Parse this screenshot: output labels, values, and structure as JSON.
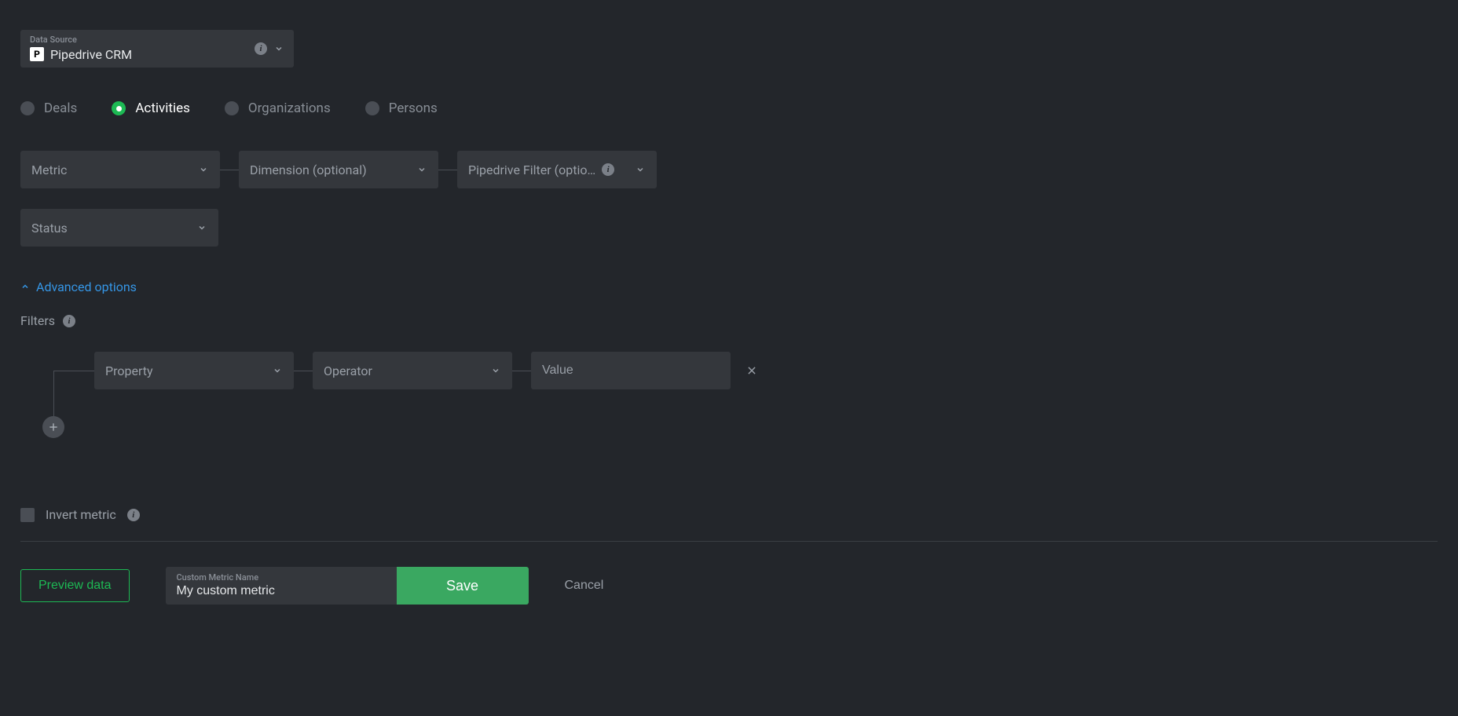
{
  "dataSource": {
    "fieldLabel": "Data Source",
    "iconLetter": "P",
    "value": "Pipedrive CRM"
  },
  "tabs": [
    {
      "label": "Deals",
      "active": false
    },
    {
      "label": "Activities",
      "active": true
    },
    {
      "label": "Organizations",
      "active": false
    },
    {
      "label": "Persons",
      "active": false
    }
  ],
  "selectors": {
    "metric": "Metric",
    "dimension": "Dimension (optional)",
    "pipedriveFilter": "Pipedrive Filter (optio…",
    "status": "Status"
  },
  "advanced": {
    "label": "Advanced options",
    "expanded": true
  },
  "filters": {
    "label": "Filters",
    "row": {
      "property": "Property",
      "operator": "Operator",
      "valuePlaceholder": "Value"
    }
  },
  "invert": {
    "label": "Invert metric",
    "checked": false
  },
  "footer": {
    "preview": "Preview data",
    "metricNameLabel": "Custom Metric Name",
    "metricNameValue": "My custom metric",
    "save": "Save",
    "cancel": "Cancel"
  }
}
